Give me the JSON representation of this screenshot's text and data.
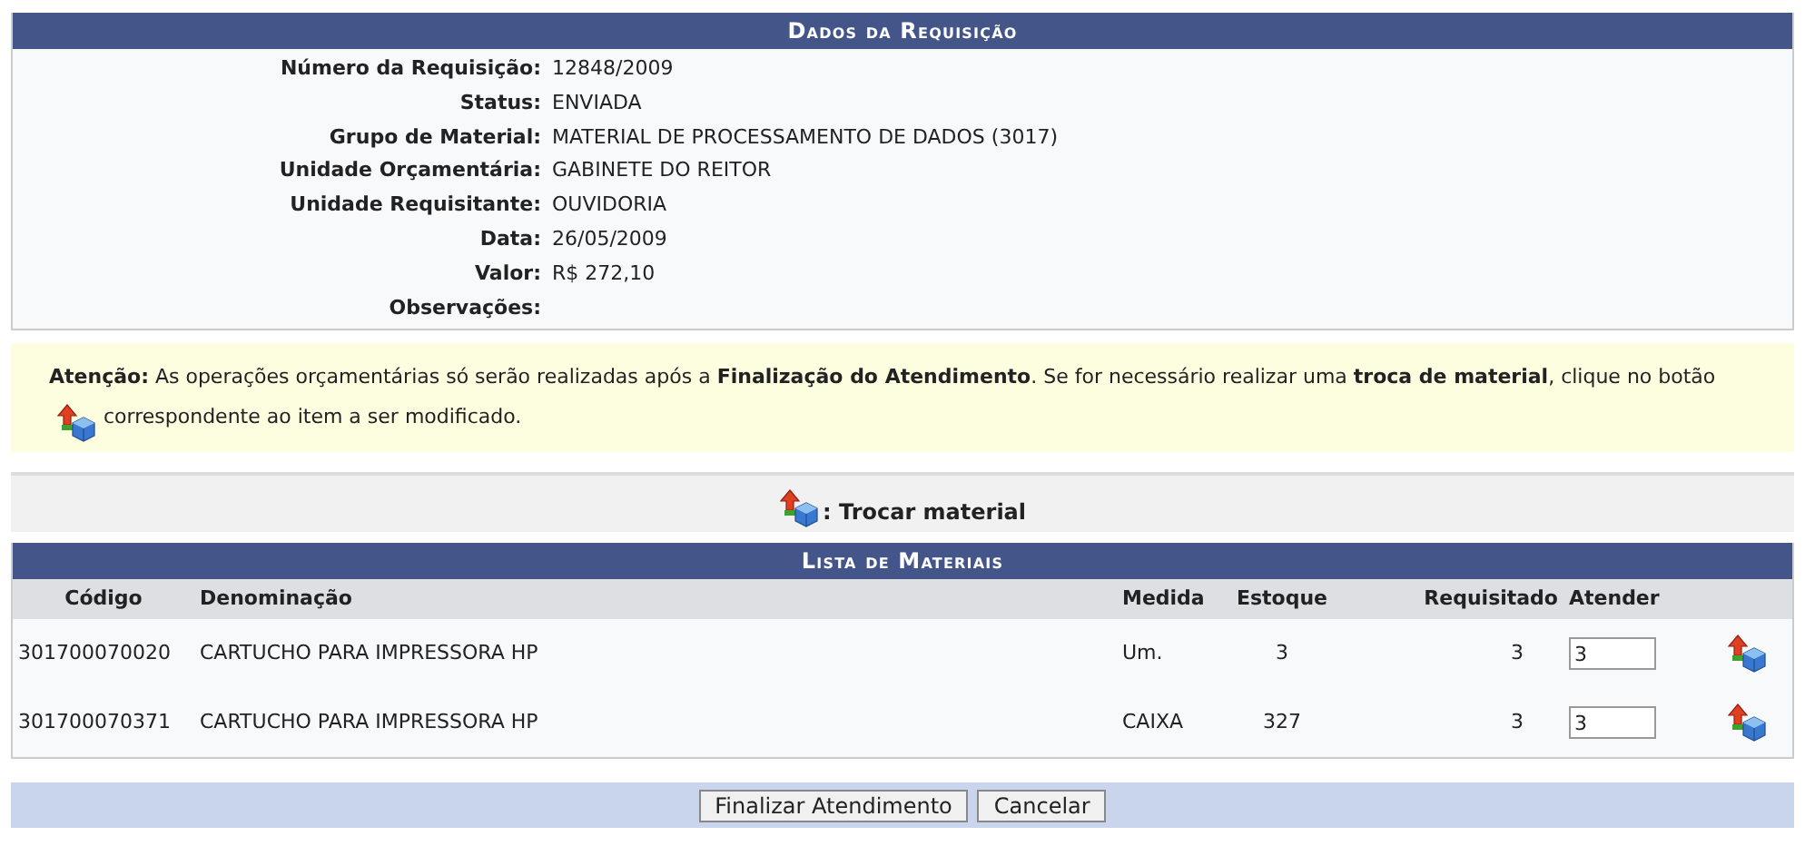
{
  "details": {
    "title": "Dados da Requisição",
    "fields": [
      {
        "label": "Número da Requisição:",
        "value": "12848/2009"
      },
      {
        "label": "Status:",
        "value": "ENVIADA"
      },
      {
        "label": "Grupo de Material:",
        "value": "MATERIAL DE PROCESSAMENTO DE DADOS (3017)"
      },
      {
        "label": "Unidade Orçamentária:",
        "value": "GABINETE DO REITOR"
      },
      {
        "label": "Unidade Requisitante:",
        "value": "OUVIDORIA"
      },
      {
        "label": "Data:",
        "value": "26/05/2009"
      },
      {
        "label": "Valor:",
        "value": "R$ 272,10"
      },
      {
        "label": "Observações:"
      }
    ]
  },
  "notice": {
    "text_before": "**Atenção:** As operações orçamentárias só serão realizadas após a **Finalização do Atendimento**. Se for necessário realizar uma **troca de material**, clique no botão",
    "text_after": "correspondente ao item a ser modificado."
  },
  "legend": {
    "label": ": Trocar material"
  },
  "materials": {
    "title": "Lista de Materiais",
    "columns": [
      "Código",
      "Denominação",
      "Medida",
      "Estoque",
      "Requisitado",
      "Atender"
    ],
    "rows": [
      {
        "codigo": "301700070020",
        "denominacao": "CARTUCHO PARA IMPRESSORA HP",
        "medida": "Um.",
        "estoque": "3",
        "requisitado": "3",
        "atender": "3"
      },
      {
        "codigo": "301700070371",
        "denominacao": "CARTUCHO PARA IMPRESSORA HP",
        "medida": "CAIXA",
        "estoque": "327",
        "requisitado": "3",
        "atender": "3"
      }
    ]
  },
  "buttons": [
    "Finalizar Atendimento",
    "Cancelar"
  ]
}
